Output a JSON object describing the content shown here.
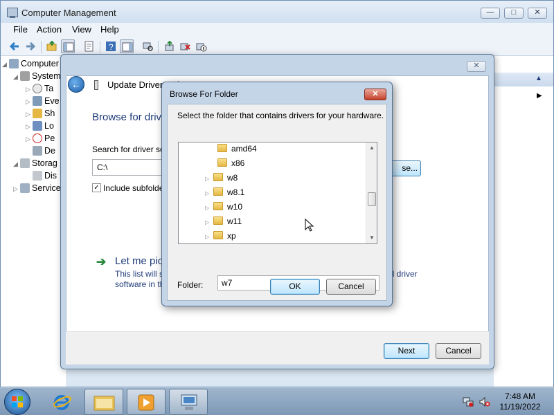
{
  "main_window": {
    "title": "Computer Management",
    "minimize": "—",
    "maximize": "□",
    "close": "✕",
    "menu": [
      "File",
      "Action",
      "View",
      "Help"
    ],
    "tree": [
      {
        "label": "Computer",
        "icon": "computer-icon"
      },
      {
        "label": "System",
        "icon": "tools-icon"
      },
      {
        "label": "Ta",
        "icon": "clock-icon"
      },
      {
        "label": "Eve",
        "icon": "event-viewer-icon"
      },
      {
        "label": "Sh",
        "icon": "shared-folders-icon"
      },
      {
        "label": "Lo",
        "icon": "users-icon"
      },
      {
        "label": "Pe",
        "icon": "performance-icon"
      },
      {
        "label": "De",
        "icon": "device-manager-icon"
      },
      {
        "label": "Storag",
        "icon": "storage-icon"
      },
      {
        "label": "Dis",
        "icon": "disk-icon"
      },
      {
        "label": "Service",
        "icon": "services-icon"
      }
    ]
  },
  "update_driver": {
    "title": "Update Driver Sof",
    "back_icon": "←",
    "close": "✕",
    "heading": "Browse for driv",
    "search_label": "Search for driver so",
    "path_value": "C:\\",
    "browse_button": "se...",
    "include_label": "Include subfolde",
    "include_checked": "✓",
    "let_me": "Let me pic",
    "desc_line1": "This list will s",
    "desc_line2": "software in th",
    "desc_right": "ll driver",
    "next_button": "Next",
    "cancel_button": "Cancel",
    "arrow_glyph": "➔"
  },
  "browse_folder": {
    "title": "Browse For Folder",
    "close": "✕",
    "message": "Select the folder that contains drivers for your hardware.",
    "items": [
      {
        "label": "amd64",
        "expander": ""
      },
      {
        "label": "x86",
        "expander": ""
      },
      {
        "label": "w8",
        "expander": "▷"
      },
      {
        "label": "w8.1",
        "expander": "▷"
      },
      {
        "label": "w10",
        "expander": "▷"
      },
      {
        "label": "w11",
        "expander": "▷"
      },
      {
        "label": "xp",
        "expander": "▷"
      }
    ],
    "scroll_up": "▲",
    "scroll_down": "▼",
    "folder_label": "Folder:",
    "folder_value": "w7",
    "ok_button": "OK",
    "cancel_button": "Cancel"
  },
  "taskbar": {
    "time": "7:48 AM",
    "date": "11/19/2022",
    "pinned": [
      "internet-explorer-icon",
      "folder-icon",
      "media-player-icon",
      "computer-management-icon"
    ],
    "tray": [
      "network-icon",
      "volume-muted-icon"
    ]
  }
}
